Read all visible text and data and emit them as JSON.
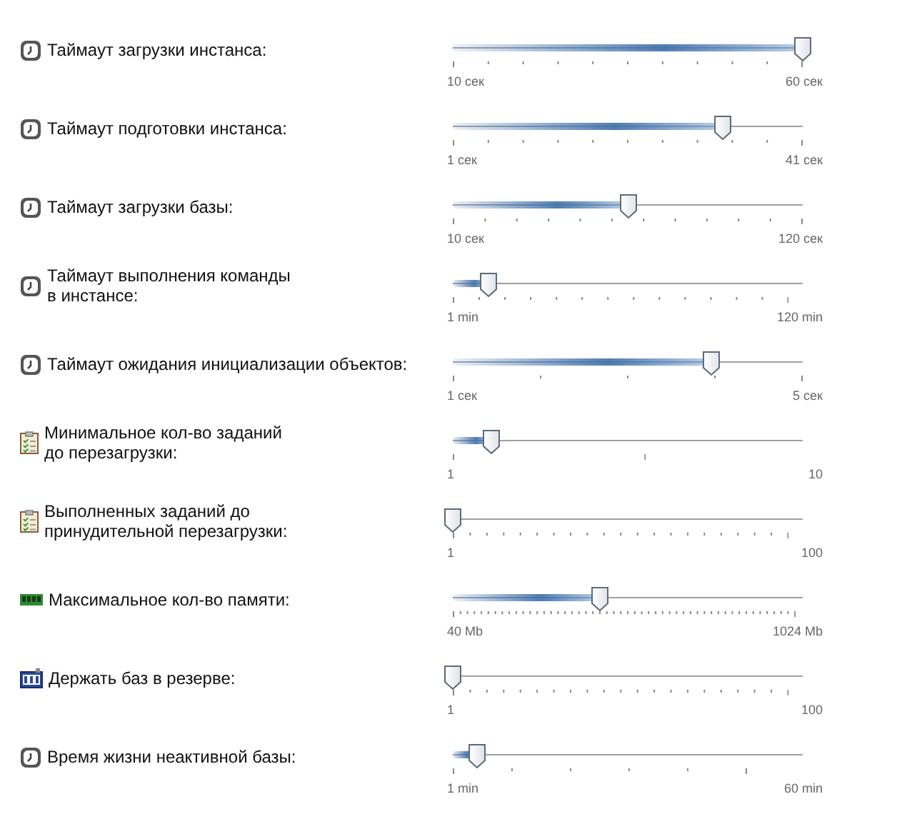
{
  "settings": [
    {
      "kind": "clock",
      "label": "Таймаут загрузки инстанса:",
      "level": 1.0,
      "min_label": "10 сек",
      "max_label": "60 сек"
    },
    {
      "kind": "clock",
      "label": "Таймаут подготовки инстанса:",
      "level": 0.77,
      "min_label": "1 сек",
      "max_label": "41 сек"
    },
    {
      "kind": "clock",
      "label": "Таймаут загрузки базы:",
      "level": 0.5,
      "min_label": "10 сек",
      "max_label": "120 сек"
    },
    {
      "kind": "clock",
      "label": "Таймаут выполнения команды\nв инстансе:",
      "level": 0.1,
      "min_label": "1 min",
      "max_label": "120 min"
    },
    {
      "kind": "clock",
      "label": "Таймаут ожидания инициализации объектов:",
      "level": 0.74,
      "min_label": "1 сек",
      "max_label": "5 сек"
    },
    {
      "kind": "tasks",
      "label": "Минимальное кол-во заданий\nдо перезагрузки:",
      "level": 0.11,
      "min_label": "1",
      "max_label": "10"
    },
    {
      "kind": "tasks",
      "label": "Выполненных заданий до\nпринудительной перезагрузки:",
      "level": 0.0,
      "min_label": "1",
      "max_label": "100"
    },
    {
      "kind": "memory",
      "label": "Максимальное кол-во памяти:",
      "level": 0.42,
      "min_label": "40 Mb",
      "max_label": "1024 Mb"
    },
    {
      "kind": "counter",
      "label": "Держать баз в резерве:",
      "level": 0.0,
      "min_label": "1",
      "max_label": "100"
    },
    {
      "kind": "clock",
      "label": "Время жизни неактивной базы:",
      "level": 0.07,
      "min_label": "1 min",
      "max_label": "60 min"
    }
  ]
}
